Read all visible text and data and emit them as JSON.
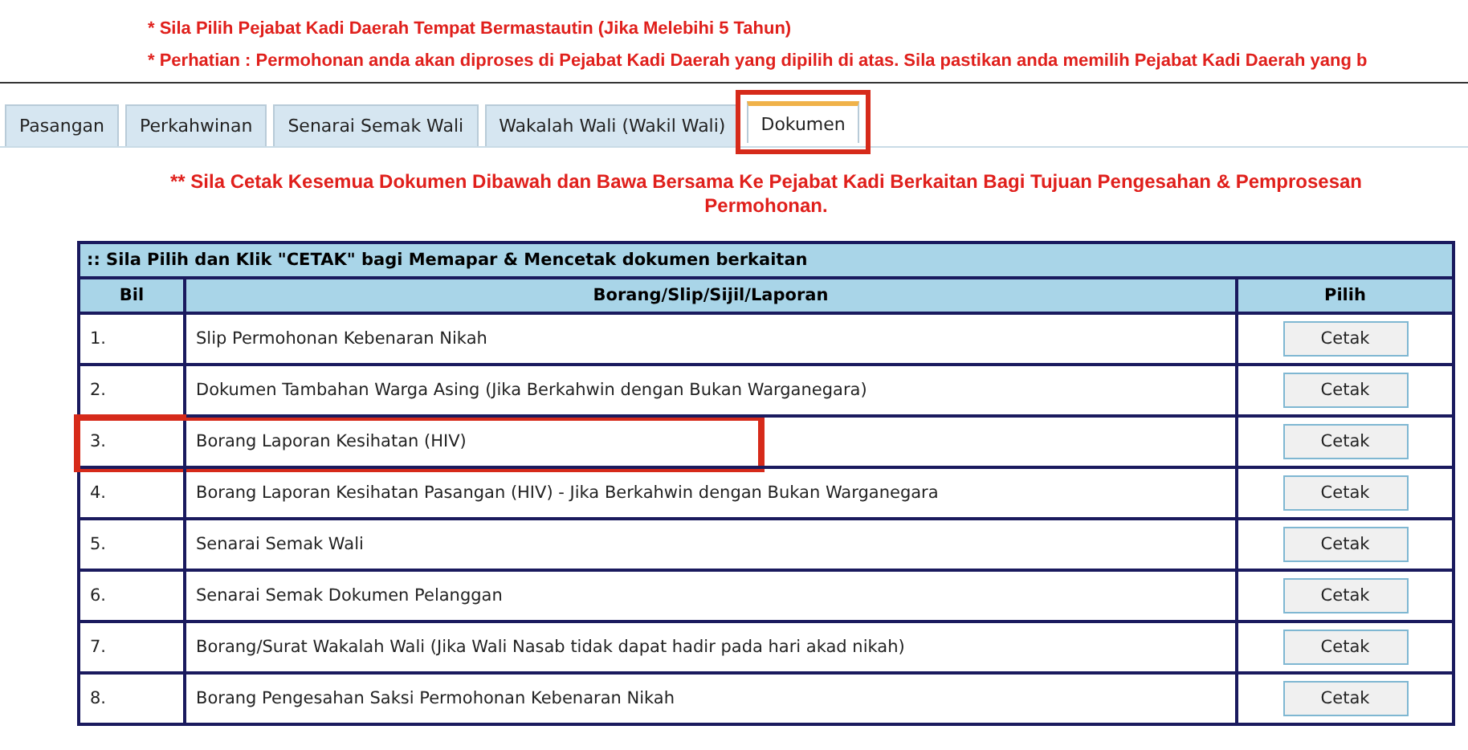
{
  "notices": [
    "* Sila Pilih Pejabat Kadi Daerah Tempat Bermastautin (Jika Melebihi 5 Tahun)",
    "* Perhatian : Permohonan anda akan diproses di Pejabat Kadi Daerah yang dipilih di atas. Sila pastikan anda memilih Pejabat Kadi Daerah yang b"
  ],
  "tabs": [
    {
      "label": "Pasangan",
      "selected": false,
      "highlighted": false
    },
    {
      "label": "Perkahwinan",
      "selected": false,
      "highlighted": false
    },
    {
      "label": "Senarai Semak Wali",
      "selected": false,
      "highlighted": false
    },
    {
      "label": "Wakalah Wali (Wakil Wali)",
      "selected": false,
      "highlighted": false
    },
    {
      "label": "Dokumen",
      "selected": true,
      "highlighted": true
    }
  ],
  "instruction": "** Sila Cetak Kesemua Dokumen Dibawah dan Bawa Bersama Ke Pejabat Kadi Berkaitan Bagi Tujuan Pengesahan & Pemprosesan Permohonan.",
  "table": {
    "title": ":: Sila Pilih dan Klik \"CETAK\" bagi Memapar & Mencetak dokumen berkaitan",
    "columns": [
      "Bil",
      "Borang/Slip/Sijil/Laporan",
      "Pilih"
    ],
    "rows": [
      {
        "bil": "1.",
        "document": "Slip Permohonan Kebenaran Nikah",
        "button": "Cetak",
        "highlighted": false
      },
      {
        "bil": "2.",
        "document": "Dokumen Tambahan Warga Asing (Jika Berkahwin dengan Bukan Warganegara)",
        "button": "Cetak",
        "highlighted": false
      },
      {
        "bil": "3.",
        "document": "Borang Laporan Kesihatan (HIV)",
        "button": "Cetak",
        "highlighted": true
      },
      {
        "bil": "4.",
        "document": "Borang Laporan Kesihatan Pasangan (HIV) - Jika Berkahwin dengan Bukan Warganegara",
        "button": "Cetak",
        "highlighted": false
      },
      {
        "bil": "5.",
        "document": "Senarai Semak Wali",
        "button": "Cetak",
        "highlighted": false
      },
      {
        "bil": "6.",
        "document": "Senarai Semak Dokumen Pelanggan",
        "button": "Cetak",
        "highlighted": false
      },
      {
        "bil": "7.",
        "document": "Borang/Surat Wakalah Wali (Jika Wali Nasab tidak dapat hadir pada hari akad nikah)",
        "button": "Cetak",
        "highlighted": false
      },
      {
        "bil": "8.",
        "document": "Borang Pengesahan Saksi Permohonan Kebenaran Nikah",
        "button": "Cetak",
        "highlighted": false
      }
    ]
  }
}
